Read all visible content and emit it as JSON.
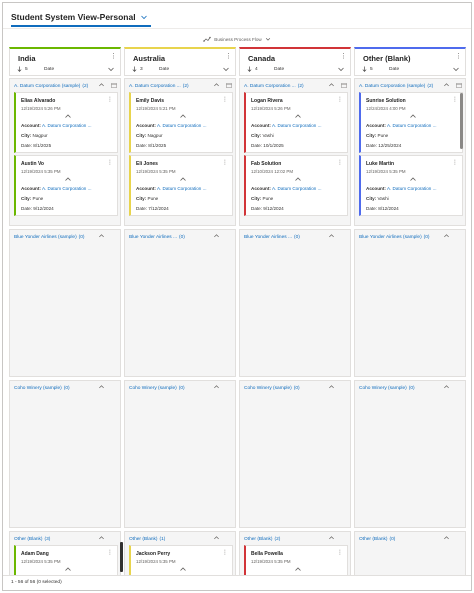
{
  "view": {
    "title": "Student System View-Personal",
    "bpf_label": "Business Process Flow"
  },
  "colors": {
    "india": "#6bb700",
    "australia": "#e8d44d",
    "canada": "#d13438",
    "other": "#4f6bed",
    "link": "#0f6cbd"
  },
  "columns": [
    {
      "title": "India",
      "count": "5",
      "sort_label": "Date",
      "lanes": [
        {
          "name": "A. Datum Corporation (sample)",
          "count": "(2)",
          "cards": [
            {
              "name": "Elias Alvarado",
              "created": "12/19/2024 5:26 PM",
              "account_label": "Account:",
              "account": "A. Datum Corporation ...",
              "city_label": "City:",
              "city": "Nagpur",
              "date_label": "Date:",
              "date": "8/1/2025"
            },
            {
              "name": "Austin Vo",
              "created": "12/19/2024 5:35 PM",
              "account_label": "Account:",
              "account": "A. Datum Corporation ...",
              "city_label": "City:",
              "city": "Pune",
              "date_label": "Date:",
              "date": "9/12/2024"
            }
          ]
        },
        {
          "name": "Blue Yonder Airlines (sample)",
          "count": "(0)",
          "cards": []
        },
        {
          "name": "Coho Winery (sample)",
          "count": "(0)",
          "cards": []
        },
        {
          "name": "Other (Blank)",
          "count": "(3)",
          "cards": [
            {
              "name": "Adam Dang",
              "created": "12/19/2024 5:35 PM"
            }
          ]
        }
      ]
    },
    {
      "title": "Australia",
      "count": "3",
      "sort_label": "Date",
      "lanes": [
        {
          "name": "A. Datum Corporation ...",
          "count": "(2)",
          "cards": [
            {
              "name": "Emily Davis",
              "created": "12/19/2024 5:21 PM",
              "account_label": "Account:",
              "account": "A. Datum Corporation ...",
              "city_label": "City:",
              "city": "Nagpur",
              "date_label": "Date:",
              "date": "8/1/2025"
            },
            {
              "name": "Eli Jones",
              "created": "12/19/2024 5:35 PM",
              "account_label": "Account:",
              "account": "A. Datum Corporation ...",
              "city_label": "City:",
              "city": "Pune",
              "date_label": "Date:",
              "date": "7/12/2024"
            }
          ]
        },
        {
          "name": "Blue Yonder Airlines ...",
          "count": "(0)",
          "cards": []
        },
        {
          "name": "Coho Winery (sample)",
          "count": "(0)",
          "cards": []
        },
        {
          "name": "Other (Blank)",
          "count": "(1)",
          "cards": [
            {
              "name": "Jackson Perry",
              "created": "12/19/2024 5:35 PM"
            }
          ]
        }
      ]
    },
    {
      "title": "Canada",
      "count": "4",
      "sort_label": "Date",
      "lanes": [
        {
          "name": "A. Datum Corporation ...",
          "count": "(2)",
          "cards": [
            {
              "name": "Logan Rivera",
              "created": "12/19/2024 5:26 PM",
              "account_label": "Account:",
              "account": "A. Datum Corporation ...",
              "city_label": "City:",
              "city": "Vashi",
              "date_label": "Date:",
              "date": "10/1/2025"
            },
            {
              "name": "Fab Solution",
              "created": "12/10/2024 12:02 PM",
              "account_label": "Account:",
              "account": "A. Datum Corporation ...",
              "city_label": "City:",
              "city": "Pune",
              "date_label": "Date:",
              "date": "9/12/2024"
            }
          ]
        },
        {
          "name": "Blue Yonder Airlines ...",
          "count": "(0)",
          "cards": []
        },
        {
          "name": "Coho Winery (sample)",
          "count": "(0)",
          "cards": []
        },
        {
          "name": "Other (Blank)",
          "count": "(2)",
          "cards": [
            {
              "name": "Bella Powella",
              "created": "12/19/2024 5:35 PM"
            }
          ]
        }
      ]
    },
    {
      "title": "Other (Blank)",
      "count": "5",
      "sort_label": "Date",
      "lanes": [
        {
          "name": "A. Datum Corporation (sample)",
          "count": "(2)",
          "cards": [
            {
              "name": "Sunrise Solution",
              "created": "12/24/2024 4:00 PM",
              "account_label": "Account:",
              "account": "A. Datum Corporation ...",
              "city_label": "City:",
              "city": "Pune",
              "date_label": "Date:",
              "date": "12/25/2024"
            },
            {
              "name": "Luke Martin",
              "created": "12/19/2024 5:35 PM",
              "account_label": "Account:",
              "account": "A. Datum Corporation ...",
              "city_label": "City:",
              "city": "Vashi",
              "date_label": "Date:",
              "date": "8/12/2024"
            }
          ]
        },
        {
          "name": "Blue Yonder Airlines (sample)",
          "count": "(0)",
          "cards": []
        },
        {
          "name": "Coho Winery (sample)",
          "count": "(0)",
          "cards": []
        },
        {
          "name": "Other (Blank)",
          "count": "(0)",
          "cards": []
        }
      ]
    }
  ],
  "status": {
    "text": "1 - 56 of 56 (0 selected)"
  }
}
